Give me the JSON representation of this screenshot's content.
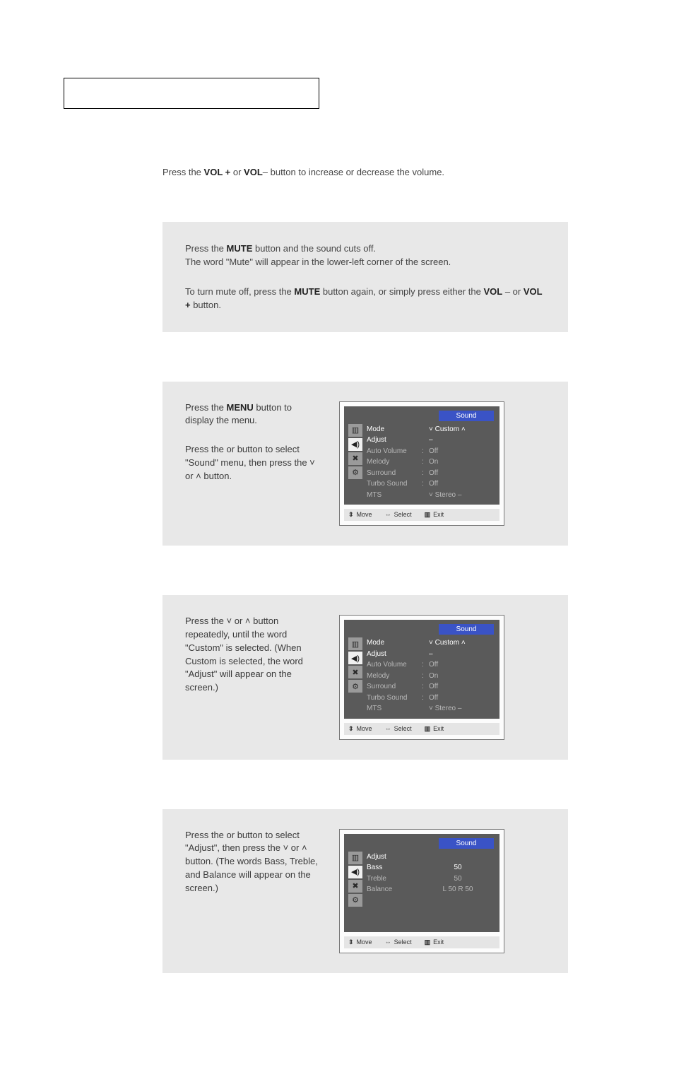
{
  "vol_instruction": {
    "prefix": "Press the ",
    "vol_plus": "VOL +",
    "or": " or ",
    "vol_minus": "VOL",
    "suffix": "– button to increase or decrease the volume."
  },
  "mute": {
    "line1_pre": "Press the ",
    "mute_btn": "MUTE",
    "line1_post": " button and the sound cuts off.",
    "line2": "The word \"Mute\" will appear in the lower-left corner of the screen.",
    "line3_pre": "To turn mute off, press the ",
    "line3_mid": " button again, or simply press either the ",
    "vol_minus": "VOL",
    "dash": " –  or ",
    "vol_plus": "VOL +",
    "line3_end": " button."
  },
  "step1": {
    "p1_pre": "Press the ",
    "menu": "MENU",
    "p1_post": " button to display the menu.",
    "p2": "Press the     or     button to select  \"Sound\" menu, then press the  ˅  or  ˄ button."
  },
  "step2": {
    "text": "Press the  ˅  or  ˄   button repeatedly, until the word \"Custom\" is selected. (When Custom is selected, the word \"Adjust\" will appear on the screen.)"
  },
  "step3": {
    "text": "Press the     or     button to select \"Adjust\", then press the  ˅  or  ˄   button. (The words Bass, Treble, and Balance will appear on the screen.)"
  },
  "osd_common": {
    "title": "Sound",
    "footer_move": "Move",
    "footer_select": "Select",
    "footer_exit": "Exit"
  },
  "osd_sound": {
    "rows": [
      {
        "label": "Mode",
        "colon": "",
        "val": "˅   Custom         ˄",
        "hi": true
      },
      {
        "label": "Adjust",
        "colon": "",
        "val": "                      –",
        "hi": true
      },
      {
        "label": "Auto Volume",
        "colon": ":",
        "val": "Off"
      },
      {
        "label": "Melody",
        "colon": ":",
        "val": "On"
      },
      {
        "label": "Surround",
        "colon": ":",
        "val": "Off"
      },
      {
        "label": "Turbo Sound",
        "colon": ":",
        "val": "Off"
      },
      {
        "label": "MTS",
        "colon": "",
        "val": "˅   Stereo            –"
      }
    ]
  },
  "osd_adjust": {
    "rows": [
      {
        "label": "Adjust",
        "val": "",
        "hi": true
      },
      {
        "label": "Bass",
        "val": "50",
        "hi": true
      },
      {
        "label": "Treble",
        "val": "50"
      },
      {
        "label": "Balance",
        "val": "L  50       R  50"
      }
    ]
  }
}
